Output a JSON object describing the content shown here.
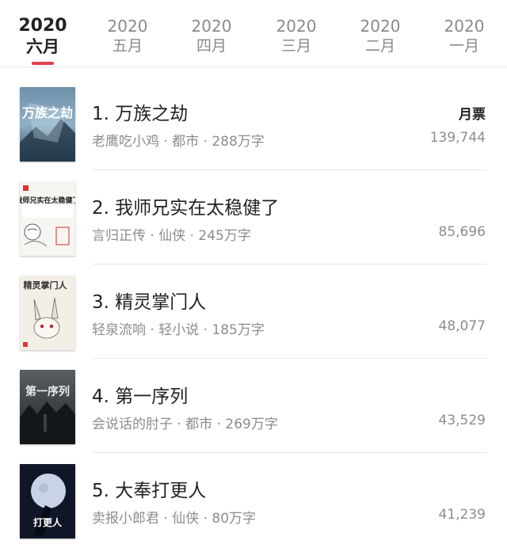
{
  "accent_color": "#e0404a",
  "tabs": [
    {
      "year": "2020",
      "month": "六月",
      "active": true
    },
    {
      "year": "2020",
      "month": "五月",
      "active": false
    },
    {
      "year": "2020",
      "month": "四月",
      "active": false
    },
    {
      "year": "2020",
      "month": "三月",
      "active": false
    },
    {
      "year": "2020",
      "month": "二月",
      "active": false
    },
    {
      "year": "2020",
      "month": "一月",
      "active": false
    }
  ],
  "list": {
    "vote_label": "月票",
    "books": [
      {
        "title": "1. 万族之劫",
        "meta": "老鹰吃小鸡 · 都市 · 288万字",
        "votes": "139,744",
        "cover_text": "万族之劫"
      },
      {
        "title": "2. 我师兄实在太稳健了",
        "meta": "言归正传 · 仙侠 · 245万字",
        "votes": "85,696",
        "cover_text": "我师兄实在太稳健了"
      },
      {
        "title": "3. 精灵掌门人",
        "meta": "轻泉流响 · 轻小说 · 185万字",
        "votes": "48,077",
        "cover_text": "精灵掌门人"
      },
      {
        "title": "4. 第一序列",
        "meta": "会说话的肘子 · 都市 · 269万字",
        "votes": "43,529",
        "cover_text": "第一序列"
      },
      {
        "title": "5. 大奉打更人",
        "meta": "卖报小郎君 · 仙侠 · 80万字",
        "votes": "41,239",
        "cover_text": "打更人"
      }
    ]
  }
}
